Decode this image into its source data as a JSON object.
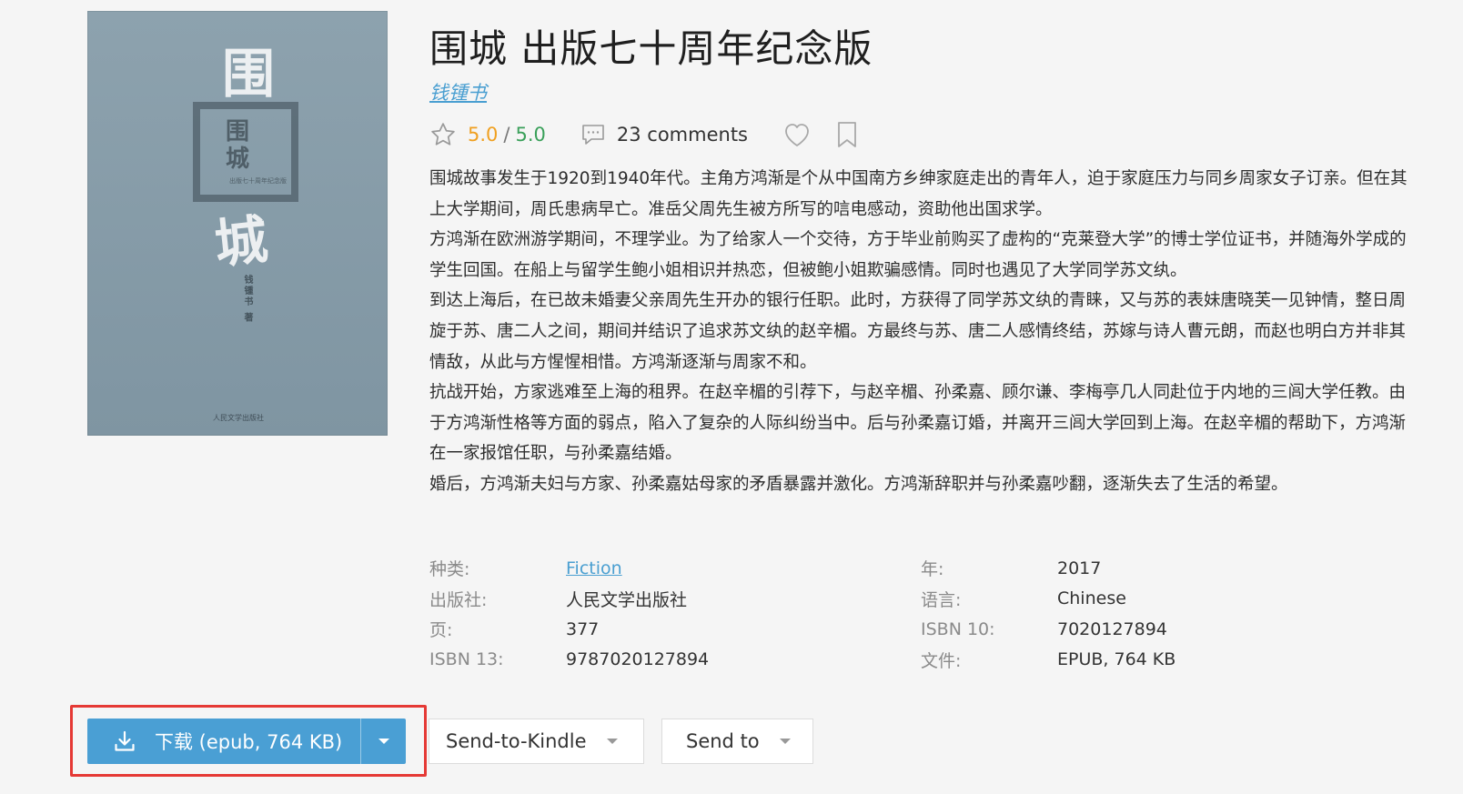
{
  "book": {
    "title": "围城 出版七十周年纪念版",
    "author": "钱锺书",
    "rating": {
      "score": "5.0",
      "separator": "/",
      "max": "5.0"
    },
    "comments_label": "23 comments",
    "description": [
      "围城故事发生于1920到1940年代。主角方鸿渐是个从中国南方乡绅家庭走出的青年人，迫于家庭压力与同乡周家女子订亲。但在其上大学期间，周氏患病早亡。准岳父周先生被方所写的唁电感动，资助他出国求学。",
      "方鸿渐在欧洲游学期间，不理学业。为了给家人一个交待，方于毕业前购买了虚构的“克莱登大学”的博士学位证书，并随海外学成的学生回国。在船上与留学生鲍小姐相识并热恋，但被鲍小姐欺骗感情。同时也遇见了大学同学苏文纨。",
      "到达上海后，在已故未婚妻父亲周先生开办的银行任职。此时，方获得了同学苏文纨的青睐，又与苏的表妹唐晓芙一见钟情，整日周旋于苏、唐二人之间，期间并结识了追求苏文纨的赵辛楣。方最终与苏、唐二人感情终结，苏嫁与诗人曹元朗，而赵也明白方并非其情敌，从此与方惺惺相惜。方鸿渐逐渐与周家不和。",
      "抗战开始，方家逃难至上海的租界。在赵辛楣的引荐下，与赵辛楣、孙柔嘉、顾尔谦、李梅亭几人同赴位于内地的三闾大学任教。由于方鸿渐性格等方面的弱点，陷入了复杂的人际纠纷当中。后与孙柔嘉订婚，并离开三闾大学回到上海。在赵辛楣的帮助下，方鸿渐在一家报馆任职，与孙柔嘉结婚。",
      "婚后，方鸿渐夫妇与方家、孙柔嘉姑母家的矛盾暴露并激化。方鸿渐辞职并与孙柔嘉吵翻，逐渐失去了生活的希望。"
    ]
  },
  "cover": {
    "char_top": "围",
    "char_bottom": "城",
    "frame_text": "围\n城",
    "frame_small": "出版七十周年纪念版",
    "author_vertical": "钱锺书 著",
    "publisher": "人民文学出版社"
  },
  "details": {
    "rows": [
      {
        "label1": "种类:",
        "value1": "Fiction",
        "label2": "年:",
        "value2": "2017"
      },
      {
        "label1": "出版社:",
        "value1": "人民文学出版社",
        "label2": "语言:",
        "value2": "Chinese"
      },
      {
        "label1": "页:",
        "value1": "377",
        "label2": "ISBN 10:",
        "value2": "7020127894"
      },
      {
        "label1": "ISBN 13:",
        "value1": "9787020127894",
        "label2": "文件:",
        "value2": "EPUB, 764 KB"
      }
    ]
  },
  "actions": {
    "download_label": "下载 (epub, 764 KB)",
    "kindle_label": "Send-to-Kindle",
    "sendto_label": "Send to"
  },
  "icons": {
    "rating": "star-icon",
    "comments": "comment-icon",
    "favorite": "heart-icon",
    "bookmark": "bookmark-icon",
    "download": "download-icon",
    "dropdown": "chevron-down-icon"
  },
  "colors": {
    "accent": "#4a9fd4",
    "rating_score": "#f0a020",
    "rating_max": "#3aa05a",
    "highlight_border": "#e53935"
  }
}
